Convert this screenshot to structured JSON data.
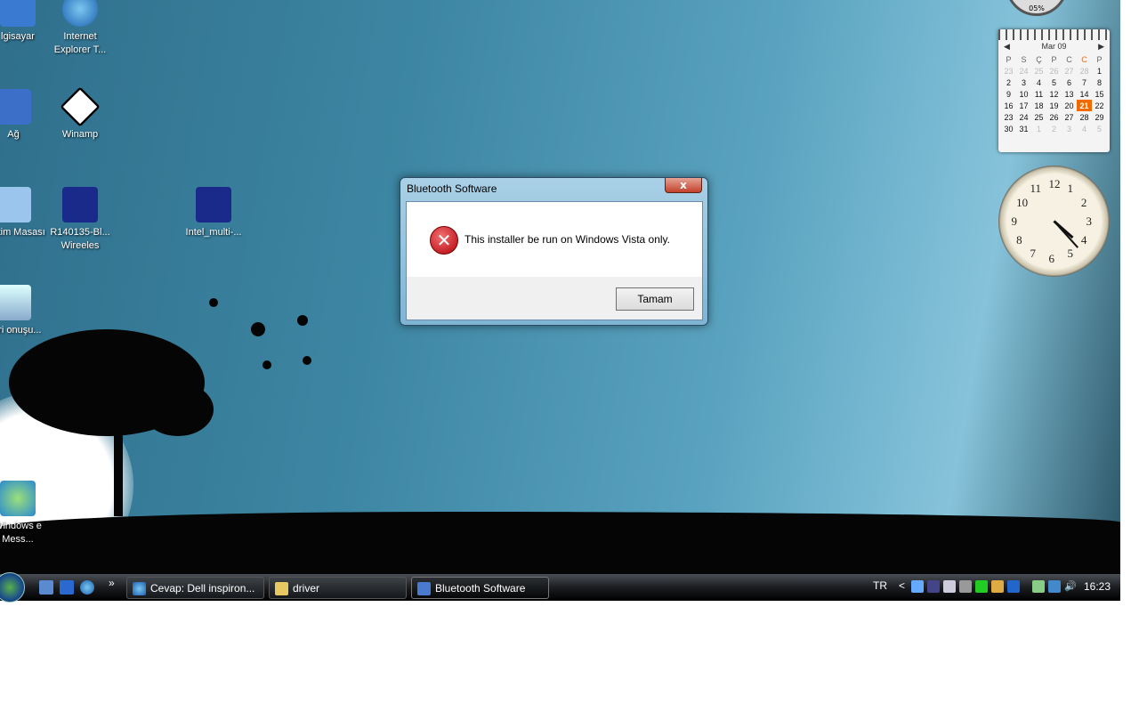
{
  "desktop": {
    "icons": [
      {
        "label": "lgisayar",
        "icon": "computer-icon"
      },
      {
        "label": "Internet Explorer T...",
        "icon": "internet-explorer-icon"
      },
      {
        "label": "Ağ",
        "icon": "network-icon"
      },
      {
        "label": "Winamp",
        "icon": "winamp-icon"
      },
      {
        "label": "enetim Masası",
        "icon": "control-panel-icon"
      },
      {
        "label": "R140135-Bl... Wireeles",
        "icon": "installer-icon"
      },
      {
        "label": "Intel_multi-...",
        "icon": "installer-icon"
      },
      {
        "label": "Geri onuşu...",
        "icon": "recycle-bin-icon"
      },
      {
        "label": "Windows e Mess...",
        "icon": "messenger-icon"
      }
    ]
  },
  "gadgets": {
    "meter": {
      "value": "05%"
    },
    "calendar": {
      "month": "Mar 09",
      "weekdays": [
        "P",
        "S",
        "Ç",
        "P",
        "C",
        "C",
        "P"
      ],
      "today": "21",
      "weeks": [
        [
          "23",
          "24",
          "25",
          "26",
          "27",
          "28",
          "1"
        ],
        [
          "2",
          "3",
          "4",
          "5",
          "6",
          "7",
          "8"
        ],
        [
          "9",
          "10",
          "11",
          "12",
          "13",
          "14",
          "15"
        ],
        [
          "16",
          "17",
          "18",
          "19",
          "20",
          "21",
          "22"
        ],
        [
          "23",
          "24",
          "25",
          "26",
          "27",
          "28",
          "29"
        ],
        [
          "30",
          "31",
          "1",
          "2",
          "3",
          "4",
          "5"
        ]
      ]
    },
    "clock": {
      "numbers": [
        "12",
        "1",
        "2",
        "3",
        "4",
        "5",
        "6",
        "7",
        "8",
        "9",
        "10",
        "11"
      ],
      "hour": 4,
      "minute": 23
    }
  },
  "dialog": {
    "title": "Bluetooth Software",
    "message": "This installer be run on Windows Vista only.",
    "ok_label": "Tamam",
    "close_label": "x",
    "icon": "error-icon"
  },
  "taskbar": {
    "overflow": "»",
    "tasks": [
      {
        "label": "Cevap: Dell inspiron...",
        "icon": "internet-explorer-icon"
      },
      {
        "label": "driver",
        "icon": "folder-icon"
      },
      {
        "label": "Bluetooth Software",
        "icon": "bluetooth-installer-icon",
        "active": true
      }
    ],
    "language": "TR",
    "tray_expand": "<",
    "clock": "16:23"
  },
  "colors": {
    "today": "#f06a00",
    "close_button": "#c2412b"
  }
}
